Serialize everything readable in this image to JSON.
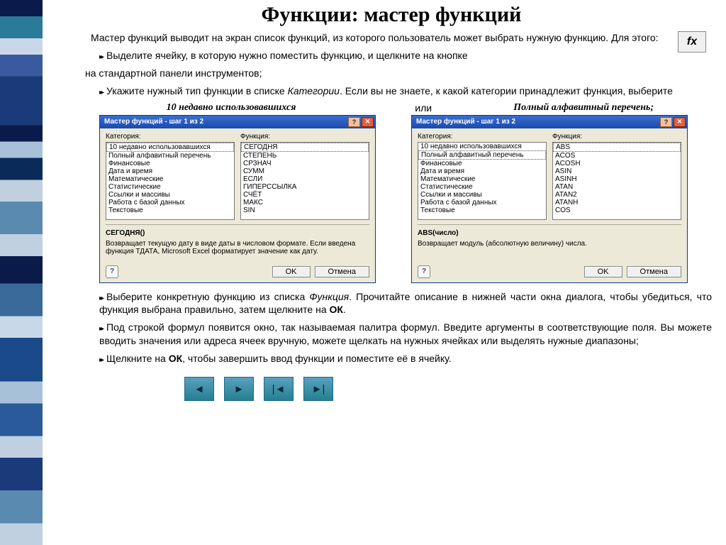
{
  "title": "Функции: мастер функций",
  "fx_label": "fх",
  "p1": "Мастер функций выводит на экран список функций, из которого пользователь может выбрать нужную функцию. Для этого:",
  "b1": "Выделите ячейку, в которую нужно поместить функцию, и щелкните на кнопке",
  "p2": "на стандартной панели инструментов;",
  "b2a": "Укажите нужный тип функции в списке ",
  "b2i": "Категории",
  "b2b": ". Если вы не знаете, к какой категории принадлежит функция, выберите",
  "lbl_left": "10 недавно использовавшихся",
  "lbl_mid": "или",
  "lbl_right": "Полный алфавитный перечень",
  "dlg": {
    "title": "Мастер функций - шаг 1 из 2",
    "cat_label": "Категория:",
    "fn_label": "Функция:",
    "help": "?",
    "ok": "OK",
    "cancel": "Отмена",
    "categories": [
      "10 недавно использовавшихся",
      "Полный алфавитный перечень",
      "Финансовые",
      "Дата и время",
      "Математические",
      "Статистические",
      "Ссылки и массивы",
      "Работа с базой данных",
      "Текстовые"
    ],
    "left": {
      "sel_cat_index": 0,
      "functions": [
        "СЕГОДНЯ",
        "СТЕПЕНЬ",
        "СРЗНАЧ",
        "СУММ",
        "ЕСЛИ",
        "ГИПЕРССЫЛКА",
        "СЧЁТ",
        "МАКС",
        "SIN"
      ],
      "sel_fn_index": 0,
      "sig": "СЕГОДНЯ()",
      "desc": "Возвращает текущую дату в виде даты в числовом формате. Если введена функция ТДАТА, Microsoft Excel форматирует значение как дату."
    },
    "right": {
      "sel_cat_index": 1,
      "functions": [
        "ABS",
        "ACOS",
        "ACOSH",
        "ASIN",
        "ASINH",
        "ATAN",
        "ATAN2",
        "ATANH",
        "COS"
      ],
      "sel_fn_index": 0,
      "sig": "ABS(число)",
      "desc": "Возвращает модуль (абсолютную величину) числа."
    }
  },
  "b3a": "Выберите конкретную функцию из списка ",
  "b3i": "Функция",
  "b3b": ". Прочитайте описание в нижней части окна диалога, чтобы убедиться, что функция выбрана правильно, затем щелкните на ",
  "b3c": "ОК",
  "b3d": ".",
  "b4": "Под строкой формул появится окно, так называемая палитра формул. Введите аргументы в соответствующие поля. Вы можете вводить значения или адреса ячеек вручную, можете щелкать на нужных ячейках или выделять нужные диапазоны;",
  "b5a": "Щелкните на ",
  "b5b": "ОК",
  "b5c": ", чтобы завершить ввод функции и поместите её в ячейку.",
  "nav": {
    "prev": "◄",
    "next": "►",
    "first": "|◄",
    "last": "►|"
  }
}
